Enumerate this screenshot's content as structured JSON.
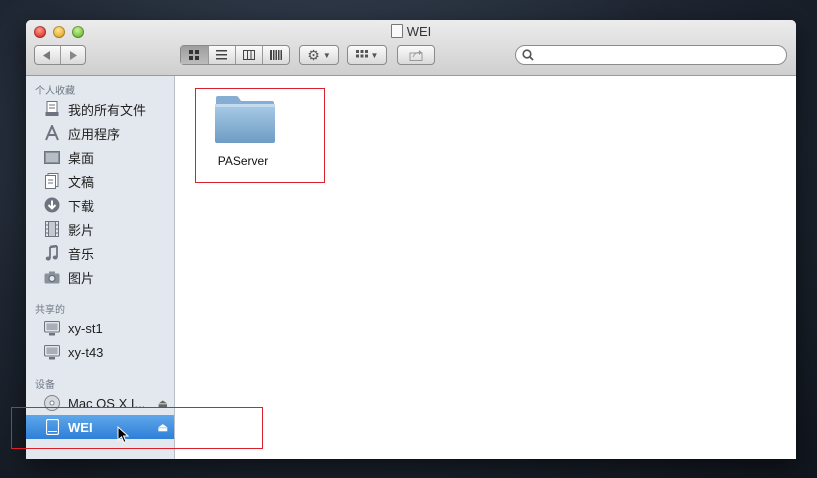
{
  "window": {
    "title": "WEI"
  },
  "toolbar": {
    "back_icon": "chevron-left-icon",
    "forward_icon": "chevron-right-icon",
    "views": [
      "icon-view",
      "list-view",
      "column-view",
      "coverflow-view"
    ],
    "action_icon": "gear-icon",
    "arrange_icon": "grid-icon",
    "share_icon": "share-icon",
    "search": {
      "placeholder": ""
    }
  },
  "sidebar": {
    "favorites_header": "个人收藏",
    "favorites": [
      {
        "label": "我的所有文件",
        "icon": "all-files-icon"
      },
      {
        "label": "应用程序",
        "icon": "applications-icon"
      },
      {
        "label": "桌面",
        "icon": "desktop-icon"
      },
      {
        "label": "文稿",
        "icon": "documents-icon"
      },
      {
        "label": "下载",
        "icon": "downloads-icon"
      },
      {
        "label": "影片",
        "icon": "movies-icon"
      },
      {
        "label": "音乐",
        "icon": "music-icon"
      },
      {
        "label": "图片",
        "icon": "pictures-icon"
      }
    ],
    "shared_header": "共享的",
    "shared": [
      {
        "label": "xy-st1",
        "icon": "computer-icon"
      },
      {
        "label": "xy-t43",
        "icon": "computer-icon"
      }
    ],
    "devices_header": "设备",
    "devices": [
      {
        "label": "Mac OS X I...",
        "icon": "disc-icon"
      },
      {
        "label": "WEI",
        "icon": "drive-icon",
        "selected": true
      }
    ]
  },
  "content": {
    "items": [
      {
        "label": "PAServer",
        "icon": "folder-icon"
      }
    ]
  },
  "colors": {
    "selection": "#3a87dc",
    "highlight_box": "#d9202b",
    "sidebar_bg": "#e3e8ee"
  }
}
